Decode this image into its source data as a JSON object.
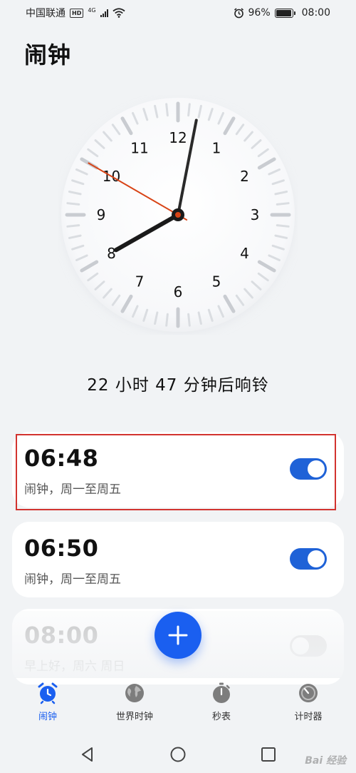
{
  "status_bar": {
    "carrier": "中国联通",
    "hd_badge": "HD",
    "network": "4G",
    "battery_percent": "96%",
    "battery_level": 0.96,
    "time": "08:00"
  },
  "page": {
    "title": "闹钟"
  },
  "clock": {
    "numerals": [
      "12",
      "1",
      "2",
      "3",
      "4",
      "5",
      "6",
      "7",
      "8",
      "9",
      "10",
      "11"
    ],
    "hour": 8,
    "minute": 1,
    "second": 50,
    "accent_color": "#d84315"
  },
  "countdown_text": "22 小时 47 分钟后响铃",
  "alarms": [
    {
      "time": "06:48",
      "desc": "闹钟，周一至周五",
      "enabled": true
    },
    {
      "time": "06:50",
      "desc": "闹钟，周一至周五",
      "enabled": true
    },
    {
      "time": "08:00",
      "desc": "早上好，周六 周日",
      "enabled": false
    }
  ],
  "bottom_nav": [
    {
      "label": "闹钟",
      "icon": "alarm-clock-icon",
      "active": true
    },
    {
      "label": "世界时钟",
      "icon": "globe-icon",
      "active": false
    },
    {
      "label": "秒表",
      "icon": "stopwatch-icon",
      "active": false
    },
    {
      "label": "计时器",
      "icon": "timer-icon",
      "active": false
    }
  ],
  "watermark": "Bai 经验",
  "colors": {
    "accent": "#1a5ff0",
    "toggle_on": "#1f62d7",
    "highlight_border": "#d2332f",
    "background": "#f1f3f5"
  }
}
